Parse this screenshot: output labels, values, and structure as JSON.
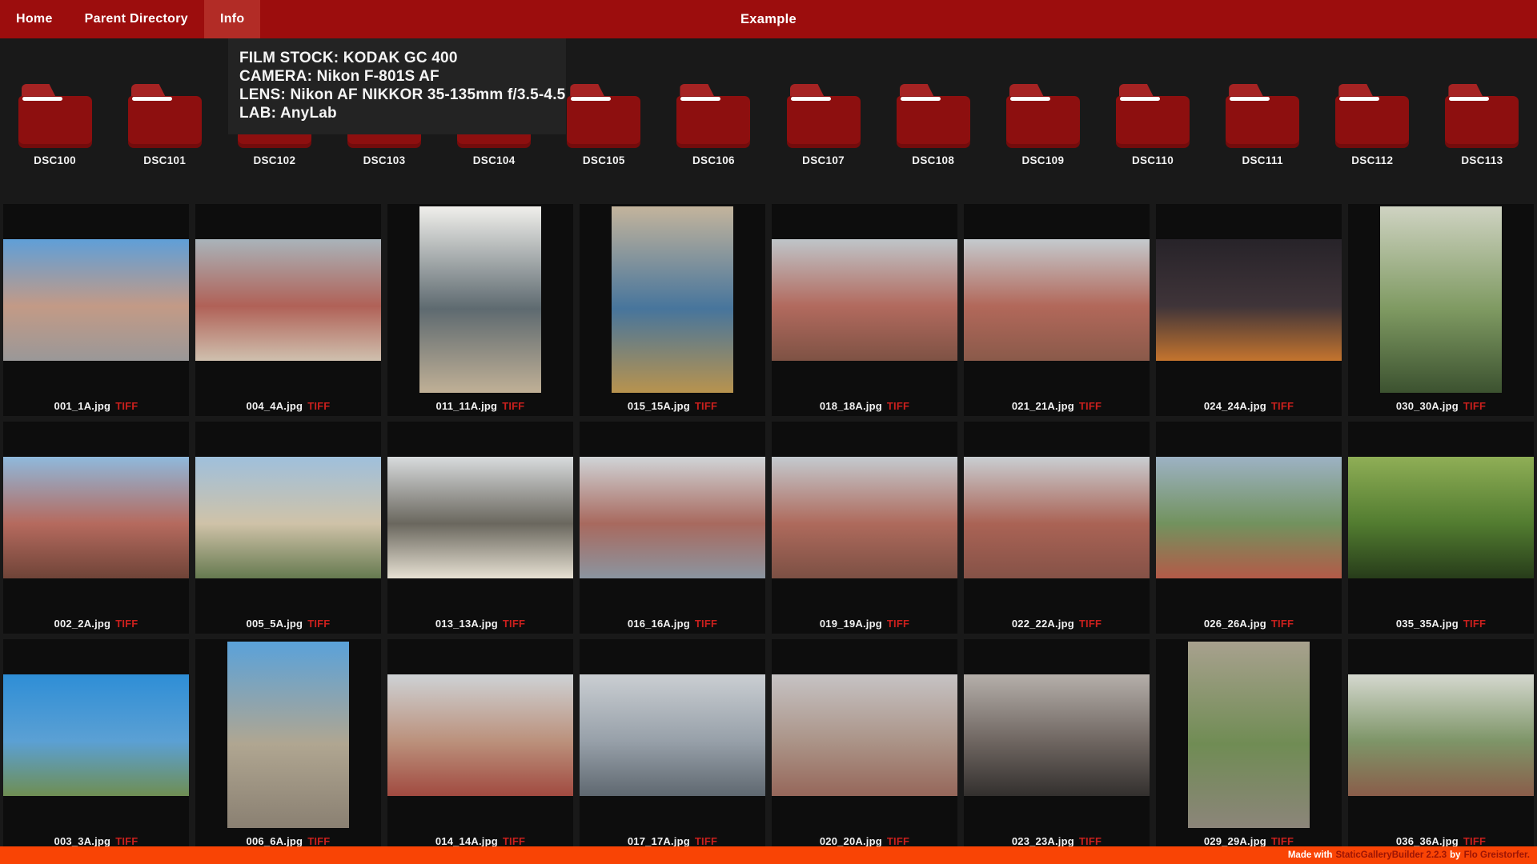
{
  "nav": {
    "items": [
      {
        "label": "Home",
        "active": false
      },
      {
        "label": "Parent Directory",
        "active": false
      },
      {
        "label": "Info",
        "active": true
      }
    ],
    "title": "Example"
  },
  "info_panel": {
    "lines": [
      "FILM STOCK: KODAK GC 400",
      "CAMERA: Nikon F-801S AF",
      "LENS: Nikon AF NIKKOR 35-135mm f/3.5-4.5",
      "LAB: AnyLab"
    ]
  },
  "folders": [
    "DSC100",
    "DSC101",
    "DSC102",
    "DSC103",
    "DSC104",
    "DSC105",
    "DSC106",
    "DSC107",
    "DSC108",
    "DSC109",
    "DSC110",
    "DSC111",
    "DSC112",
    "DSC113"
  ],
  "gallery": {
    "rows": [
      [
        {
          "file": "001_1A.jpg",
          "badge": "TIFF",
          "orientation": "landscape",
          "palette": [
            "#5f9fd8",
            "#c39a86",
            "#9a9898"
          ]
        },
        {
          "file": "004_4A.jpg",
          "badge": "TIFF",
          "orientation": "landscape",
          "palette": [
            "#a9b4ba",
            "#b06157",
            "#cfc0ae"
          ]
        },
        {
          "file": "011_11A.jpg",
          "badge": "TIFF",
          "orientation": "portrait",
          "palette": [
            "#f0efeb",
            "#5e6a70",
            "#c0b096"
          ]
        },
        {
          "file": "015_15A.jpg",
          "badge": "TIFF",
          "orientation": "portrait",
          "palette": [
            "#c3b49c",
            "#47759c",
            "#b8934e"
          ]
        },
        {
          "file": "018_18A.jpg",
          "badge": "TIFF",
          "orientation": "landscape",
          "palette": [
            "#bfc5c9",
            "#b26a5e",
            "#7e5244"
          ]
        },
        {
          "file": "021_21A.jpg",
          "badge": "TIFF",
          "orientation": "landscape",
          "palette": [
            "#c4cace",
            "#b2685a",
            "#8a5a4a"
          ]
        },
        {
          "file": "024_24A.jpg",
          "badge": "TIFF",
          "orientation": "landscape",
          "palette": [
            "#272329",
            "#3f3439",
            "#c4742e"
          ]
        },
        {
          "file": "030_30A.jpg",
          "badge": "TIFF",
          "orientation": "portrait",
          "palette": [
            "#cfd3c2",
            "#7f9a62",
            "#3c5230"
          ]
        }
      ],
      [
        {
          "file": "002_2A.jpg",
          "badge": "TIFF",
          "orientation": "landscape",
          "palette": [
            "#8fb9dc",
            "#b56a5e",
            "#6f4438"
          ]
        },
        {
          "file": "005_5A.jpg",
          "badge": "TIFF",
          "orientation": "landscape",
          "palette": [
            "#9fc0dc",
            "#cfc2a8",
            "#667a50"
          ]
        },
        {
          "file": "013_13A.jpg",
          "badge": "TIFF",
          "orientation": "landscape",
          "palette": [
            "#d8dbdd",
            "#6a675e",
            "#e6e0d2"
          ]
        },
        {
          "file": "016_16A.jpg",
          "badge": "TIFF",
          "orientation": "landscape",
          "palette": [
            "#d0d4d7",
            "#a8695e",
            "#8b95a0"
          ]
        },
        {
          "file": "019_19A.jpg",
          "badge": "TIFF",
          "orientation": "landscape",
          "palette": [
            "#c4cacf",
            "#ae6a5c",
            "#7c5044"
          ]
        },
        {
          "file": "022_22A.jpg",
          "badge": "TIFF",
          "orientation": "landscape",
          "palette": [
            "#c9ced2",
            "#aa6355",
            "#855247"
          ]
        },
        {
          "file": "026_26A.jpg",
          "badge": "TIFF",
          "orientation": "landscape",
          "palette": [
            "#9db2c4",
            "#72925e",
            "#b45a48"
          ]
        },
        {
          "file": "035_35A.jpg",
          "badge": "TIFF",
          "orientation": "landscape",
          "palette": [
            "#8fae56",
            "#527c30",
            "#273c1a"
          ]
        }
      ],
      [
        {
          "file": "003_3A.jpg",
          "badge": "TIFF",
          "orientation": "landscape",
          "palette": [
            "#2e8ed6",
            "#5ba0d4",
            "#6f8e52"
          ]
        },
        {
          "file": "006_6A.jpg",
          "badge": "TIFF",
          "orientation": "portrait",
          "palette": [
            "#5aa2da",
            "#b0a691",
            "#8a8072"
          ]
        },
        {
          "file": "014_14A.jpg",
          "badge": "TIFF",
          "orientation": "landscape",
          "palette": [
            "#ced2d5",
            "#bb917c",
            "#a14a40"
          ]
        },
        {
          "file": "017_17A.jpg",
          "badge": "TIFF",
          "orientation": "landscape",
          "palette": [
            "#caced2",
            "#97a0a9",
            "#5f6870"
          ]
        },
        {
          "file": "020_20A.jpg",
          "badge": "TIFF",
          "orientation": "landscape",
          "palette": [
            "#c6c3c4",
            "#ab9488",
            "#96675a"
          ]
        },
        {
          "file": "023_23A.jpg",
          "badge": "TIFF",
          "orientation": "landscape",
          "palette": [
            "#b5afaa",
            "#6f6661",
            "#33302e"
          ]
        },
        {
          "file": "029_29A.jpg",
          "badge": "TIFF",
          "orientation": "portrait",
          "palette": [
            "#a8a18e",
            "#708c54",
            "#8c857a"
          ]
        },
        {
          "file": "036_36A.jpg",
          "badge": "TIFF",
          "orientation": "landscape",
          "palette": [
            "#d5d8cf",
            "#7e9568",
            "#8a5d4a"
          ]
        }
      ]
    ]
  },
  "footer": {
    "prefix": "Made with",
    "builder": "StaticGalleryBuilder 2.2.3",
    "connector": "by",
    "author": "Flo Greistorfer."
  },
  "colors": {
    "navbar": "#9c0d0d",
    "nav_active": "#b22c26",
    "page_bg": "#191919",
    "tile_bg": "#0d0d0d",
    "folder_red": "#8d0f0f",
    "badge_red": "#c9201d",
    "footer_orange": "#f94405",
    "footer_link": "#9c1405"
  }
}
